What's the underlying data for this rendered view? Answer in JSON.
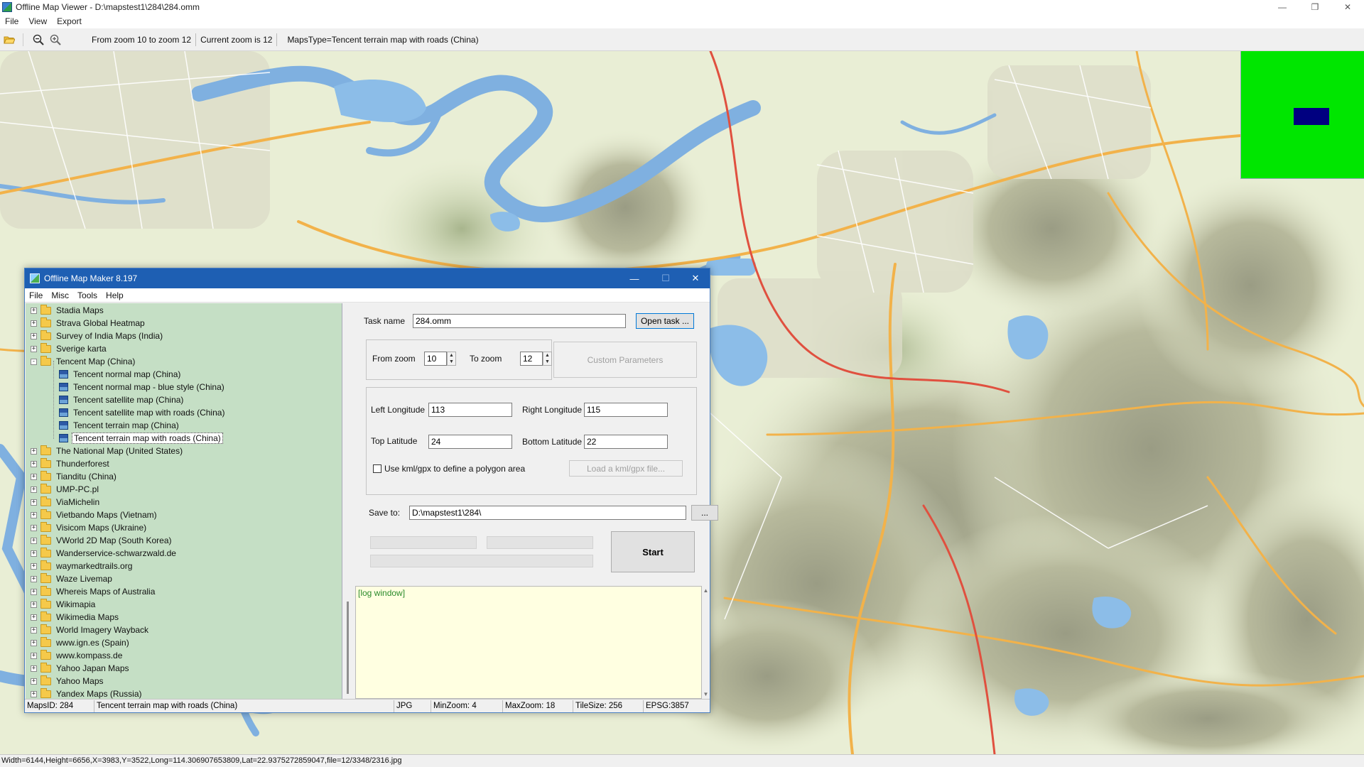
{
  "window": {
    "title": "Offline Map Viewer - D:\\mapstest1\\284\\284.omm",
    "controls": {
      "minimize": "—",
      "maximize": "❐",
      "close": "✕"
    }
  },
  "menu": [
    "File",
    "View",
    "Export"
  ],
  "toolbar": {
    "zoom_range": "From zoom 10 to zoom 12",
    "current_zoom": "Current zoom is 12",
    "maps_type": "MapsType=Tencent terrain map with roads (China)"
  },
  "colors": {
    "minimap_bg": "#00e600",
    "minimap_view": "#000080",
    "dialog_title": "#1e5fb3",
    "tree_bg": "#c5dfc5",
    "log_bg": "#ffffe1",
    "log_text": "#2a8a2a"
  },
  "statusbar": {
    "text": "Width=6144,Height=6656,X=3983,Y=3522,Long=114.306907653809,Lat=22.9375272859047,file=12/3348/2316.jpg"
  },
  "dialog": {
    "title": "Offline Map Maker 8.197",
    "controls": {
      "minimize": "—",
      "maximize": "☐",
      "close": "✕"
    },
    "menu": [
      "File",
      "Misc",
      "Tools",
      "Help"
    ],
    "tree": [
      {
        "label": "Stadia Maps",
        "level": 0,
        "kind": "folder",
        "expander": "+"
      },
      {
        "label": "Strava Global Heatmap",
        "level": 0,
        "kind": "folder",
        "expander": "+"
      },
      {
        "label": "Survey of India Maps (India)",
        "level": 0,
        "kind": "folder",
        "expander": "+"
      },
      {
        "label": "Sverige karta",
        "level": 0,
        "kind": "folder",
        "expander": "+"
      },
      {
        "label": "Tencent Map (China)",
        "level": 0,
        "kind": "folder",
        "expander": "-"
      },
      {
        "label": "Tencent normal map (China)",
        "level": 1,
        "kind": "map"
      },
      {
        "label": "Tencent normal map - blue style (China)",
        "level": 1,
        "kind": "map"
      },
      {
        "label": "Tencent satellite map (China)",
        "level": 1,
        "kind": "map"
      },
      {
        "label": "Tencent satellite map with roads (China)",
        "level": 1,
        "kind": "map"
      },
      {
        "label": "Tencent terrain map (China)",
        "level": 1,
        "kind": "map"
      },
      {
        "label": "Tencent terrain map with roads (China)",
        "level": 1,
        "kind": "map",
        "selected": true
      },
      {
        "label": "The National Map (United States)",
        "level": 0,
        "kind": "folder",
        "expander": "+"
      },
      {
        "label": "Thunderforest",
        "level": 0,
        "kind": "folder",
        "expander": "+"
      },
      {
        "label": "Tianditu (China)",
        "level": 0,
        "kind": "folder",
        "expander": "+"
      },
      {
        "label": "UMP-PC.pl",
        "level": 0,
        "kind": "folder",
        "expander": "+"
      },
      {
        "label": "ViaMichelin",
        "level": 0,
        "kind": "folder",
        "expander": "+"
      },
      {
        "label": "Vietbando Maps (Vietnam)",
        "level": 0,
        "kind": "folder",
        "expander": "+"
      },
      {
        "label": "Visicom Maps (Ukraine)",
        "level": 0,
        "kind": "folder",
        "expander": "+"
      },
      {
        "label": "VWorld 2D Map (South Korea)",
        "level": 0,
        "kind": "folder",
        "expander": "+"
      },
      {
        "label": "Wanderservice-schwarzwald.de",
        "level": 0,
        "kind": "folder",
        "expander": "+"
      },
      {
        "label": "waymarkedtrails.org",
        "level": 0,
        "kind": "folder",
        "expander": "+"
      },
      {
        "label": "Waze Livemap",
        "level": 0,
        "kind": "folder",
        "expander": "+"
      },
      {
        "label": "Whereis Maps of Australia",
        "level": 0,
        "kind": "folder",
        "expander": "+"
      },
      {
        "label": "Wikimapia",
        "level": 0,
        "kind": "folder",
        "expander": "+"
      },
      {
        "label": "Wikimedia Maps",
        "level": 0,
        "kind": "folder",
        "expander": "+"
      },
      {
        "label": "World Imagery Wayback",
        "level": 0,
        "kind": "folder",
        "expander": "+"
      },
      {
        "label": "www.ign.es (Spain)",
        "level": 0,
        "kind": "folder",
        "expander": "+"
      },
      {
        "label": "www.kompass.de",
        "level": 0,
        "kind": "folder",
        "expander": "+"
      },
      {
        "label": "Yahoo Japan Maps",
        "level": 0,
        "kind": "folder",
        "expander": "+"
      },
      {
        "label": "Yahoo Maps",
        "level": 0,
        "kind": "folder",
        "expander": "+"
      },
      {
        "label": "Yandex Maps (Russia)",
        "level": 0,
        "kind": "folder",
        "expander": "+"
      }
    ],
    "form": {
      "task_name_label": "Task name",
      "task_name_value": "284.omm",
      "open_task": "Open task ...",
      "from_zoom_label": "From zoom",
      "from_zoom_value": "10",
      "to_zoom_label": "To zoom",
      "to_zoom_value": "12",
      "custom_parameters": "Custom Parameters",
      "left_longitude_label": "Left Longitude",
      "left_longitude_value": "113",
      "right_longitude_label": "Right Longitude",
      "right_longitude_value": "115",
      "top_latitude_label": "Top Latitude",
      "top_latitude_value": "24",
      "bottom_latitude_label": "Bottom Latitude",
      "bottom_latitude_value": "22",
      "use_kml_label": "Use kml/gpx to define a polygon area",
      "use_kml_checked": false,
      "load_kml": "Load a kml/gpx file...",
      "save_to_label": "Save to:",
      "save_to_value": "D:\\mapstest1\\284\\",
      "browse": "...",
      "start": "Start"
    },
    "log_text": "[log window]",
    "status": {
      "maps_id": "MapsID: 284",
      "maps_name": "Tencent terrain map with roads (China)",
      "format": "JPG",
      "min_zoom": "MinZoom: 4",
      "max_zoom": "MaxZoom: 18",
      "tile_size": "TileSize: 256",
      "epsg": "EPSG:3857"
    }
  }
}
